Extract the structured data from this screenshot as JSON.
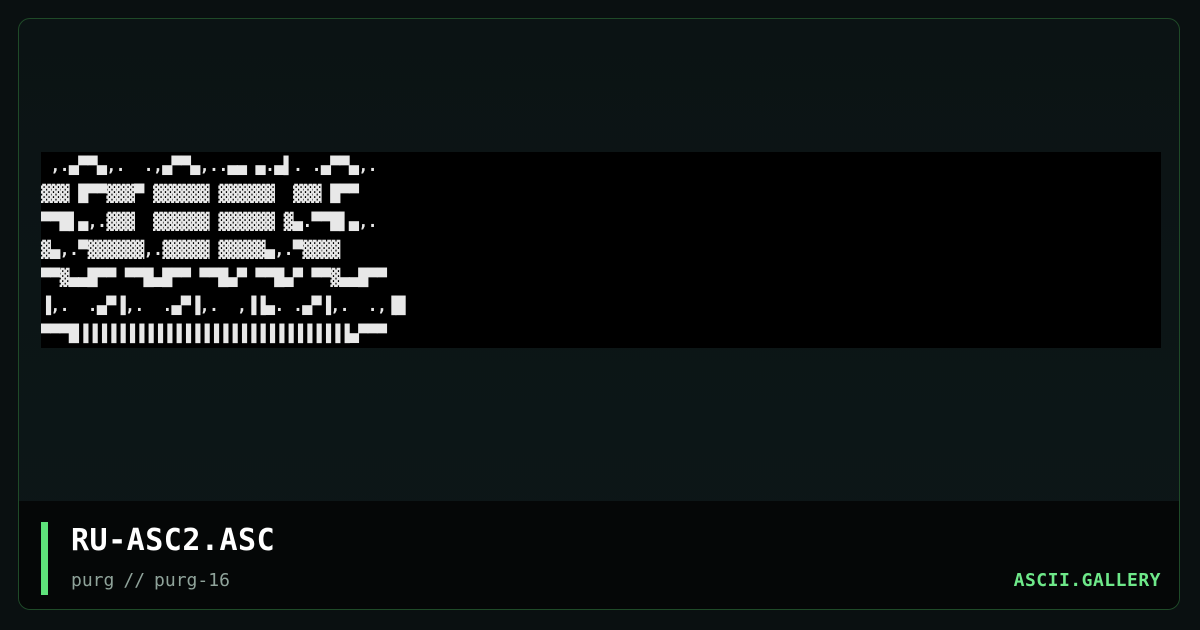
{
  "artwork": {
    "lines": [
      " ,.▄▀▀▄,.  .,▄▀▀▄,..▄▄ ▄.▄▌. .▄▀▀▄,.",
      "▓▓▓ █▀▀▓▓▓▀ ▓▓▓▓▓▓ ▓▓▓▓▓▓  ▓▓▓ █▀▀",
      "▀▀█▌▄,.▓▓▓  ▓▓▓▓▓▓ ▓▓▓▓▓▓ ▓▄.▀▀█▌▄,.",
      "▓▄,.▀▓▓▓▓▓▓,.▓▓▓▓▓ ▓▓▓▓▓▄,.▀▓▓▓▓",
      "▀▀▓▄▄█▀▀ ▀▀█▄█▀▀ ▀▀█▄▀ ▀▀█▄▀ ▀▀▓▄▄█▀▀",
      "▐,.  .▄▀▐,.  .▄▀▐,.  ,▐▐▄. .▄▀▐,.  .,▐█",
      "▀▀▀█▐▐▐▐▐▐▐▐▐▐▐▐▐▐▐▐▐▐▐▐▐▐▐▐▐▐▐▐▐▄▀▀▀"
    ]
  },
  "footer": {
    "file_title": "RU-ASC2.ASC",
    "artist": "purg",
    "separator": "//",
    "pack": "purg-16",
    "site_label": "ASCII.GALLERY"
  },
  "colors": {
    "accent": "#5ee27a",
    "site_link": "#6ee889",
    "frame_border": "#1f4a28",
    "background": "#0a1011"
  }
}
